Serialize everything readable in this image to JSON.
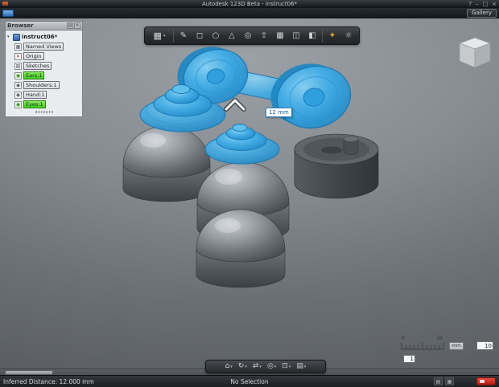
{
  "window": {
    "title": "Autodesk 123D Beta - instruct06*",
    "help": "?",
    "minimize": "–",
    "maximize": "□",
    "close": "×"
  },
  "menubar": {
    "gallery": "Gallery"
  },
  "browser": {
    "title": "Browser",
    "root_label": "instruct06*",
    "buttons": [
      {
        "name": "browser-menu-button",
        "glyph": "▤"
      },
      {
        "name": "browser-close-button",
        "glyph": "✕"
      }
    ],
    "items": [
      {
        "label": "Named Views",
        "glyph": "▦",
        "style": "plain"
      },
      {
        "label": "Origin",
        "glyph": "✕",
        "style": "plain"
      },
      {
        "label": "Sketches",
        "glyph": "▨",
        "style": "plain"
      },
      {
        "label": "Ears:1",
        "glyph": "◉",
        "style": "green"
      },
      {
        "label": "Shoulders:1",
        "glyph": "◉",
        "style": "plain"
      },
      {
        "label": "Hand:1",
        "glyph": "◉",
        "style": "plain"
      },
      {
        "label": "Eyes:1",
        "glyph": "◉",
        "style": "green"
      }
    ]
  },
  "toolbar": {
    "menu_glyph": "▦",
    "caret": "▾",
    "icons": [
      {
        "name": "sketch-icon",
        "glyph": "✎"
      },
      {
        "name": "box-icon",
        "glyph": "◻"
      },
      {
        "name": "sphere-icon",
        "glyph": "○"
      },
      {
        "name": "cone-icon",
        "glyph": "△"
      },
      {
        "name": "torus-icon",
        "glyph": "◎"
      },
      {
        "name": "extrude-icon",
        "glyph": "⇧"
      },
      {
        "name": "pattern-icon",
        "glyph": "▦"
      },
      {
        "name": "mirror-icon",
        "glyph": "◫"
      },
      {
        "name": "combine-icon",
        "glyph": "◧"
      },
      {
        "name": "material-icon",
        "glyph": "✦"
      },
      {
        "name": "settings-icon",
        "glyph": "☼"
      }
    ]
  },
  "tooltip": {
    "text": "12 mm"
  },
  "ruler": {
    "start": "0",
    "end": "10",
    "unit": "mm",
    "spacing": "10",
    "subdivision": "1"
  },
  "nav_toolbar": {
    "caret": "▾",
    "icons": [
      {
        "name": "home-view-icon",
        "glyph": "⌂"
      },
      {
        "name": "orbit-icon",
        "glyph": "↻"
      },
      {
        "name": "pan-icon",
        "glyph": "⇄"
      },
      {
        "name": "zoom-icon",
        "glyph": "◎"
      },
      {
        "name": "fit-view-icon",
        "glyph": "⊡"
      },
      {
        "name": "display-settings-icon",
        "glyph": "▤"
      }
    ]
  },
  "statusbar": {
    "left": "Inferred Distance: 12.000 mm",
    "center": "No Selection",
    "icons": [
      {
        "name": "display-mode-icon",
        "glyph": "▤"
      },
      {
        "name": "grid-toggle-icon",
        "glyph": "▦"
      }
    ]
  },
  "colors": {
    "selection_blue": "#35a5e2",
    "highlight_green": "#46c926",
    "model_gray": "#6a7076"
  }
}
